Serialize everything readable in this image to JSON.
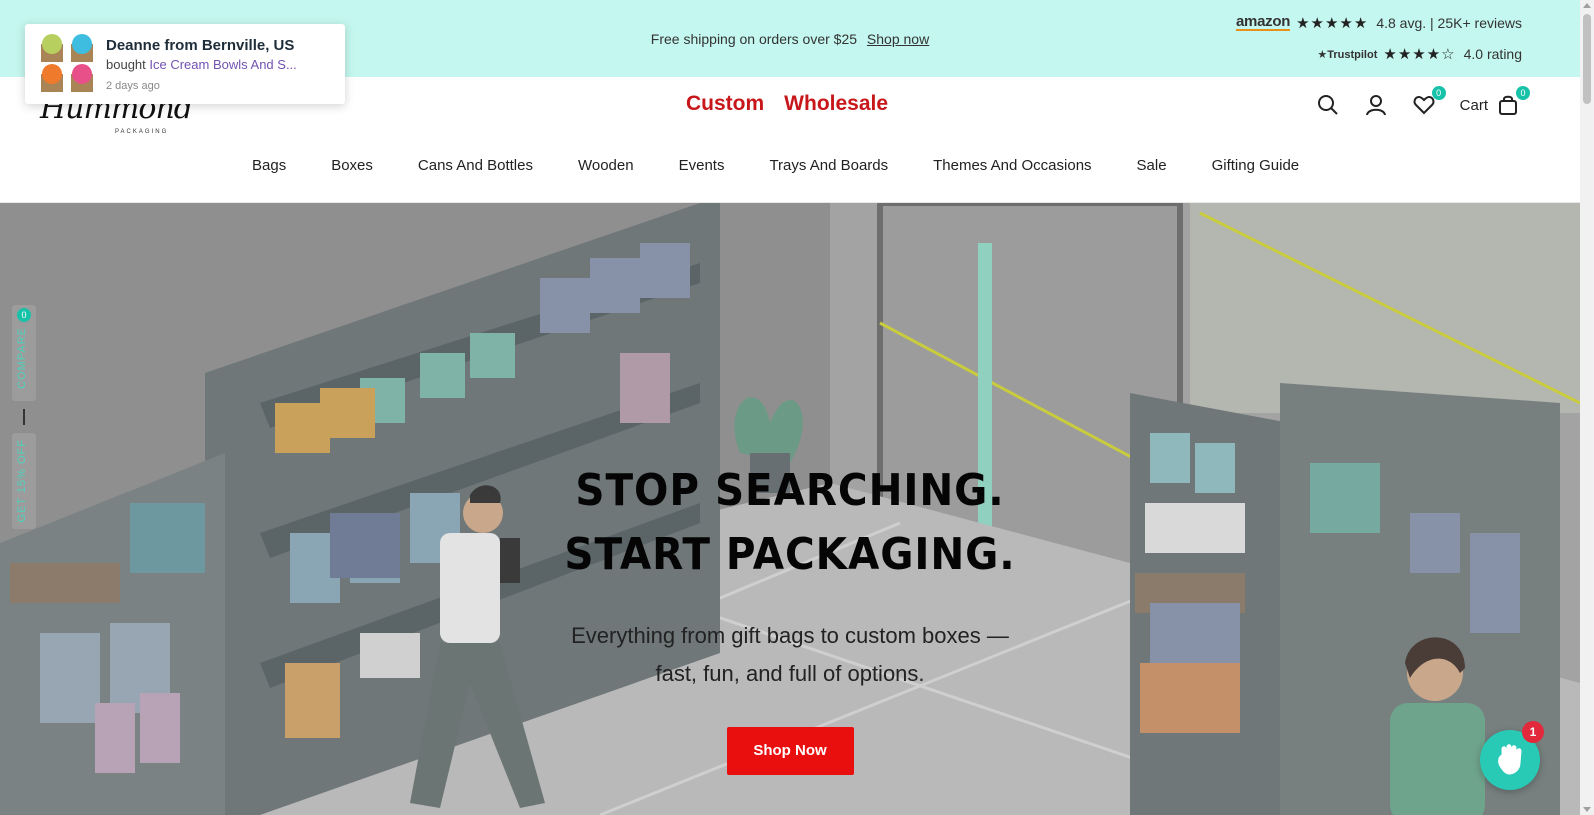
{
  "announcement": {
    "text": "Free shipping on orders over $25",
    "link": "Shop now",
    "bg_color": "#c4f7ef"
  },
  "reviews": {
    "amazon": {
      "brand": "amazon",
      "stars": "★★★★★",
      "text": "4.8 avg. | 25K+ reviews"
    },
    "trustpilot": {
      "brand": "★Trustpilot",
      "stars": "★★★★☆",
      "text": "4.0 rating"
    }
  },
  "header": {
    "logo_script": "Hummond",
    "logo_sub": "PACKAGING",
    "top_links": [
      "Custom",
      "Wholesale"
    ],
    "wishlist_count": "0",
    "cart_label": "Cart",
    "cart_count": "0",
    "accent_color": "#c8171b"
  },
  "nav": [
    "Bags",
    "Boxes",
    "Cans And Bottles",
    "Wooden",
    "Events",
    "Trays And Boards",
    "Themes And Occasions",
    "Sale",
    "Gifting Guide"
  ],
  "hero": {
    "headline_1": "STOP SEARCHING.",
    "headline_2": "START PACKAGING.",
    "subtitle_1": "Everything from gift bags to custom boxes —",
    "subtitle_2": "fast, fun, and full of options.",
    "cta": "Shop Now",
    "cta_color": "#ea0f0f"
  },
  "side_tab": {
    "compare_label": "COMPARE",
    "compare_count": "0",
    "discount_label": "GET 15% OFF"
  },
  "popup": {
    "name": "Deanne from Bernville, US",
    "bought_prefix": "bought",
    "product": "Ice Cream Bowls And S...",
    "time": "2 days ago"
  },
  "chat": {
    "badge": "1"
  }
}
